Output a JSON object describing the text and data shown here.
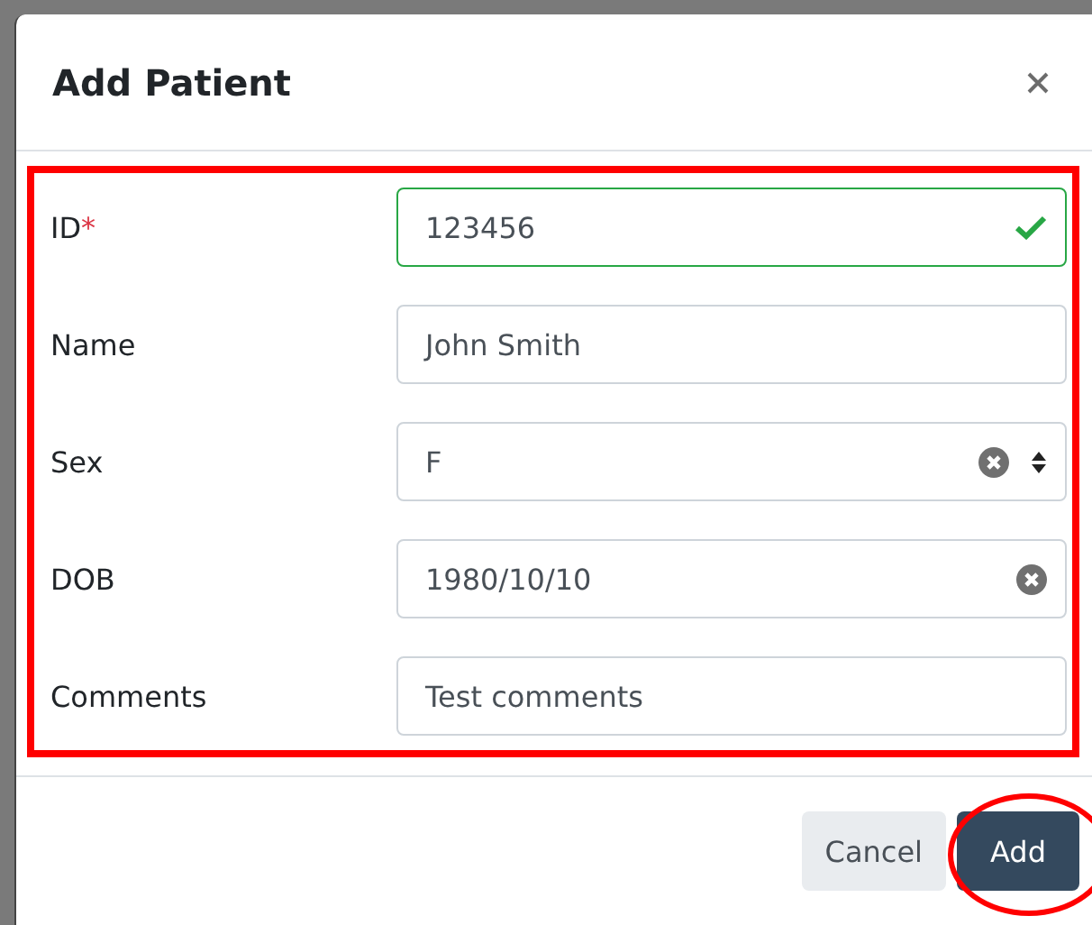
{
  "dialog": {
    "title": "Add Patient"
  },
  "fields": [
    {
      "label": "ID",
      "required": true,
      "kind": "text",
      "value": "123456",
      "valid": true,
      "clearable": false
    },
    {
      "label": "Name",
      "required": false,
      "kind": "text",
      "value": "John Smith",
      "valid": false,
      "clearable": false
    },
    {
      "label": "Sex",
      "required": false,
      "kind": "select",
      "value": "F",
      "valid": false,
      "clearable": true
    },
    {
      "label": "DOB",
      "required": false,
      "kind": "date",
      "value": "1980/10/10",
      "valid": false,
      "clearable": true
    },
    {
      "label": "Comments",
      "required": false,
      "kind": "text",
      "value": "Test comments",
      "valid": false,
      "clearable": false
    }
  ],
  "buttons": [
    {
      "label": "Cancel",
      "kind": "secondary",
      "highlighted": false
    },
    {
      "label": "Add",
      "kind": "primary",
      "highlighted": true
    }
  ],
  "required_mark": "*"
}
